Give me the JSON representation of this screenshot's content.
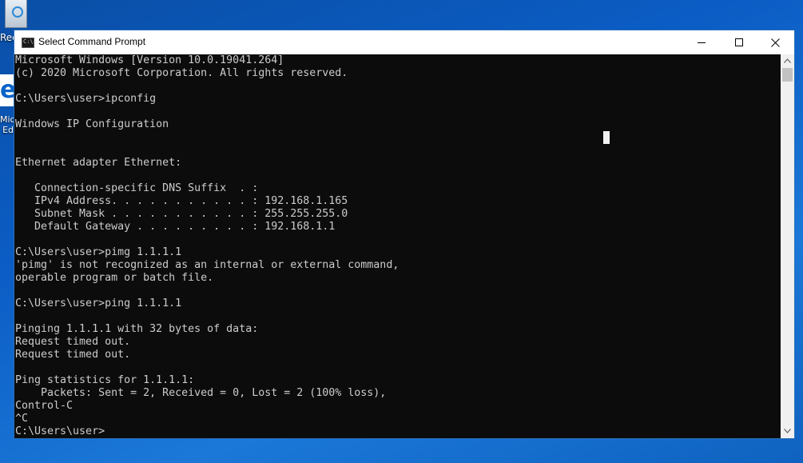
{
  "desktop": {
    "recycle_label": "Recycle Bin",
    "edge_label_line1": "Micro",
    "edge_label_line2": "Ed"
  },
  "window": {
    "title": "Select Command Prompt",
    "icon_glyph": "C:\\"
  },
  "console": {
    "lines": [
      "Microsoft Windows [Version 10.0.19041.264]",
      "(c) 2020 Microsoft Corporation. All rights reserved.",
      "",
      "C:\\Users\\user>ipconfig",
      "",
      "Windows IP Configuration",
      "",
      "",
      "Ethernet adapter Ethernet:",
      "",
      "   Connection-specific DNS Suffix  . :",
      "   IPv4 Address. . . . . . . . . . . : 192.168.1.165",
      "   Subnet Mask . . . . . . . . . . . : 255.255.255.0",
      "   Default Gateway . . . . . . . . . : 192.168.1.1",
      "",
      "C:\\Users\\user>pimg 1.1.1.1",
      "'pimg' is not recognized as an internal or external command,",
      "operable program or batch file.",
      "",
      "C:\\Users\\user>ping 1.1.1.1",
      "",
      "Pinging 1.1.1.1 with 32 bytes of data:",
      "Request timed out.",
      "Request timed out.",
      "",
      "Ping statistics for 1.1.1.1:",
      "    Packets: Sent = 2, Received = 0, Lost = 2 (100% loss),",
      "Control-C",
      "^C",
      "C:\\Users\\user>"
    ]
  }
}
